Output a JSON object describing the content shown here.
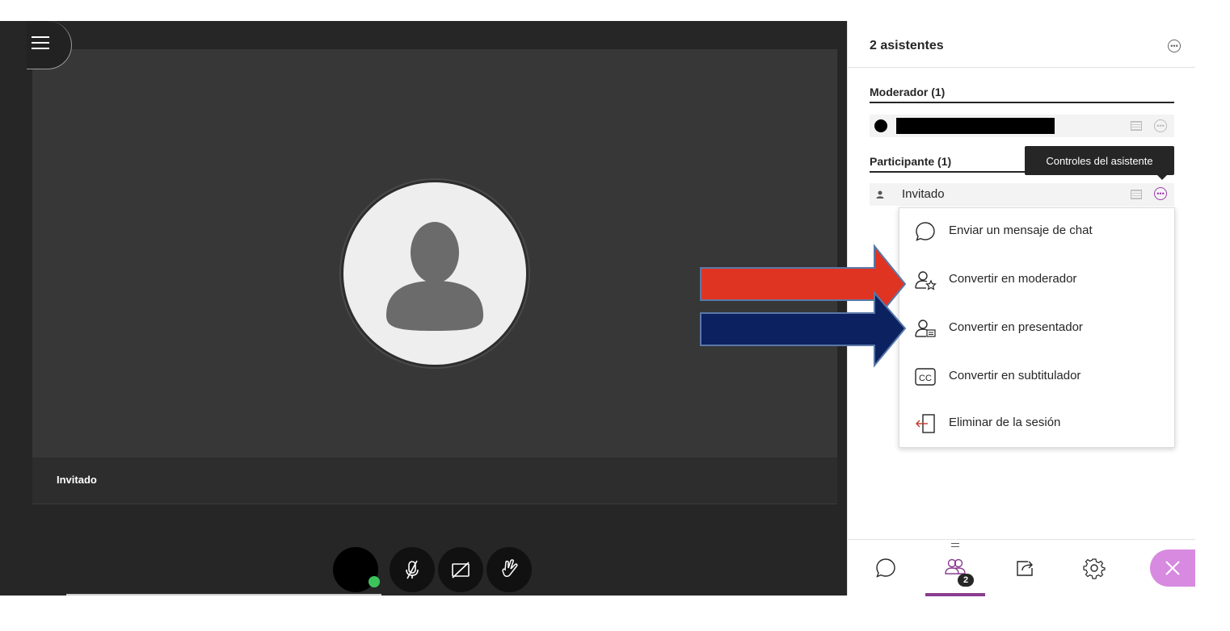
{
  "video": {
    "participant_name": "Invitado"
  },
  "controls": {
    "items": [
      "avatar",
      "microphone-off",
      "camera-off",
      "raise-hand"
    ]
  },
  "panel": {
    "title": "2 asistentes",
    "moderators_header": "Moderador (1)",
    "participants_header": "Participante (1)",
    "participant_name": "Invitado",
    "tooltip": "Controles del asistente",
    "menu": [
      {
        "label": "Enviar un mensaje de chat",
        "icon": "chat-bubble-icon"
      },
      {
        "label": "Convertir en moderador",
        "icon": "moderator-icon"
      },
      {
        "label": "Convertir en presentador",
        "icon": "presenter-icon"
      },
      {
        "label": "Convertir en subtitulador",
        "icon": "captioner-icon"
      },
      {
        "label": "Eliminar de la sesión",
        "icon": "remove-icon"
      }
    ],
    "attendee_count_badge": "2"
  },
  "colors": {
    "accent": "#8a3c8f",
    "close_button": "#d78ae0",
    "red_arrow": "#e03423",
    "blue_arrow": "#0c2160"
  }
}
